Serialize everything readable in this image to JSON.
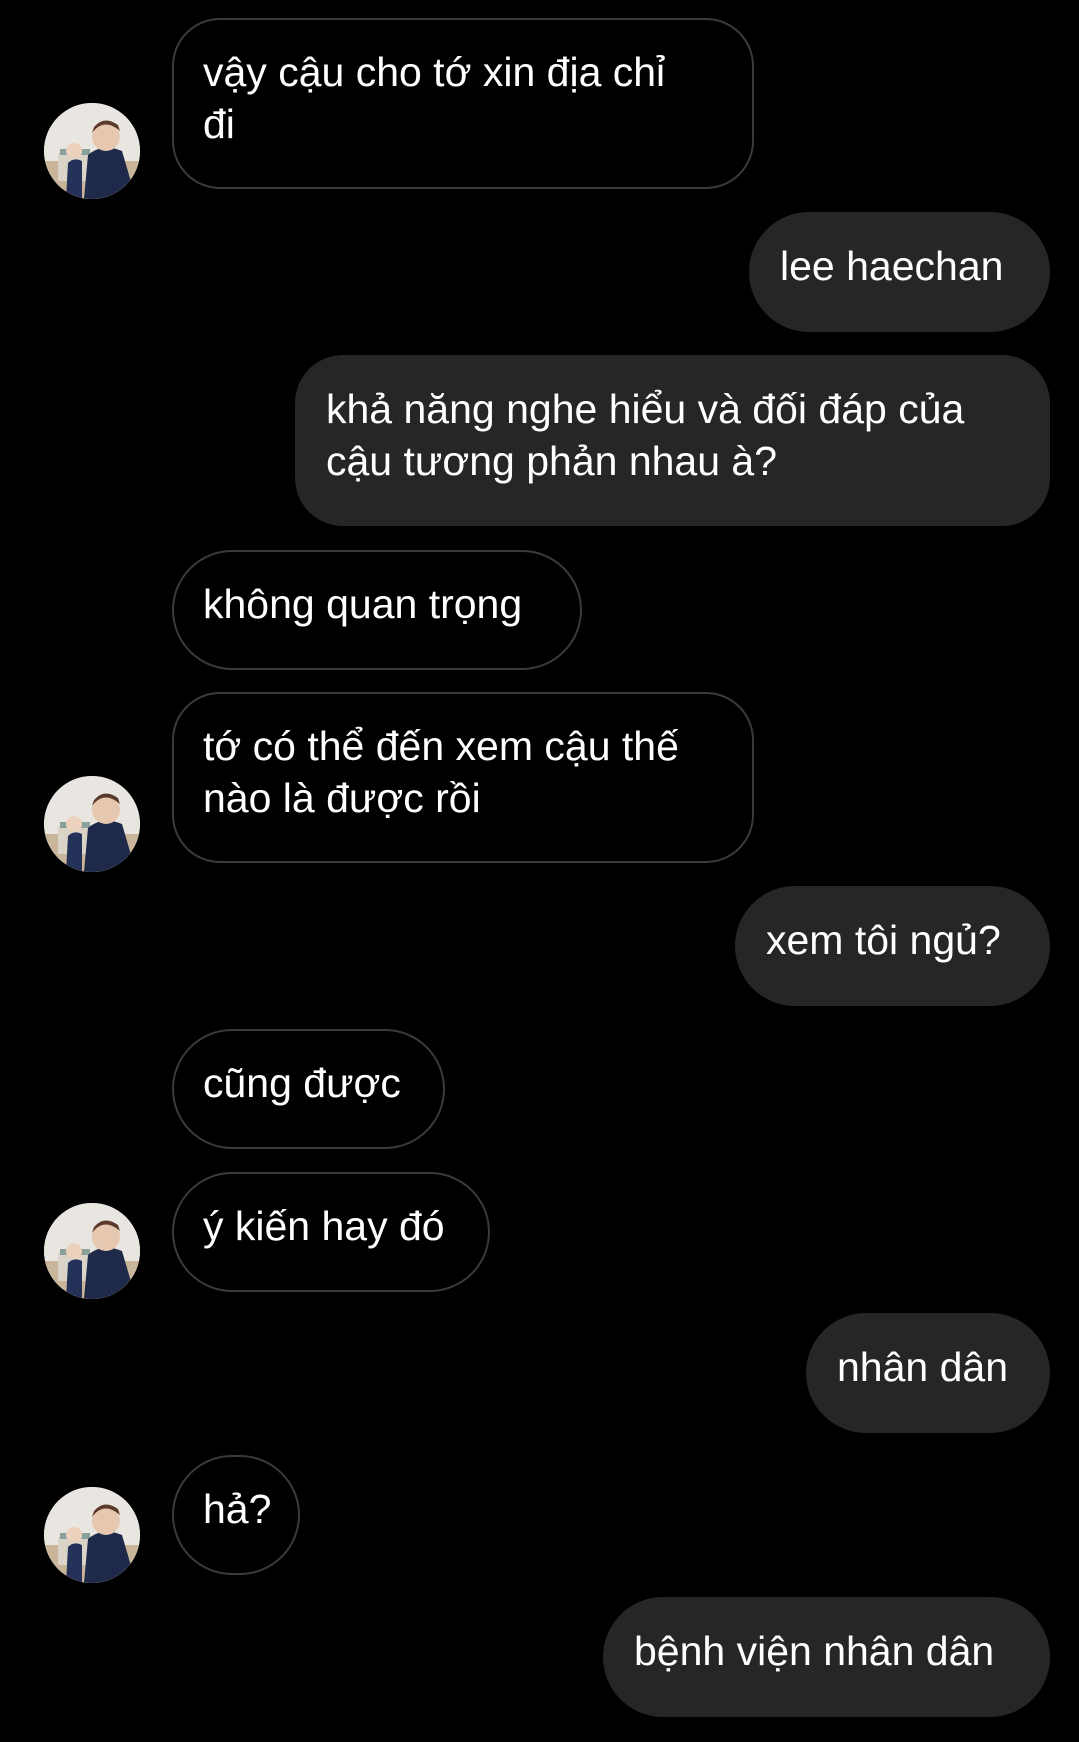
{
  "conversation": {
    "messages": [
      {
        "from": "them",
        "text": "vậy cậu cho tớ xin địa chỉ\nđi"
      },
      {
        "from": "me",
        "text": "lee haechan"
      },
      {
        "from": "me",
        "text": "khả năng nghe hiểu và đối đáp của\ncậu tương phản nhau à?"
      },
      {
        "from": "them",
        "text": "không quan trọng"
      },
      {
        "from": "them",
        "text": "tớ có thể đến xem cậu thế\nnào là được rồi"
      },
      {
        "from": "me",
        "text": "xem tôi ngủ?"
      },
      {
        "from": "them",
        "text": "cũng được"
      },
      {
        "from": "them",
        "text": "ý kiến hay đó"
      },
      {
        "from": "me",
        "text": "nhân dân"
      },
      {
        "from": "them",
        "text": "hả?"
      },
      {
        "from": "me",
        "text": "bệnh viện nhân dân"
      }
    ],
    "avatar_icon": "contact-avatar-photo"
  },
  "colors": {
    "background": "#000000",
    "sent_bubble": "#262626",
    "received_border": "#3a3a3a",
    "text": "#ffffff"
  }
}
